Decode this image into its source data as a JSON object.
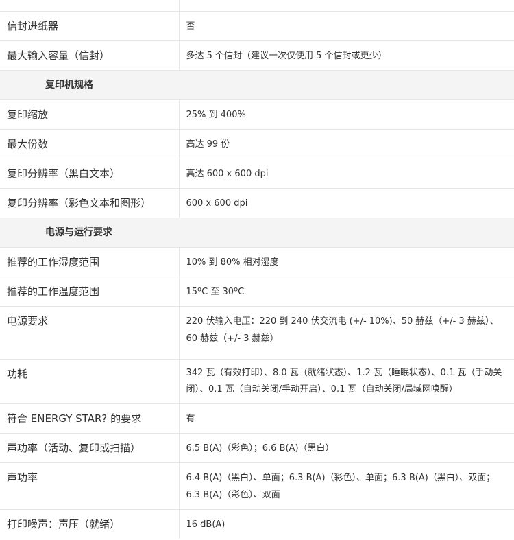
{
  "rows": [
    {
      "type": "row",
      "label": "",
      "value": ""
    },
    {
      "type": "row",
      "label": "信封进纸器",
      "value": "否"
    },
    {
      "type": "row",
      "label": "最大输入容量（信封）",
      "value": "多达 5 个信封（建议一次仅使用 5 个信封或更少）"
    },
    {
      "type": "section",
      "label": "复印机规格"
    },
    {
      "type": "row",
      "label": "复印缩放",
      "value": "25% 到 400%"
    },
    {
      "type": "row",
      "label": "最大份数",
      "value": "高达 99 份"
    },
    {
      "type": "row",
      "label": "复印分辨率（黑白文本）",
      "value": "高达 600 x 600 dpi"
    },
    {
      "type": "row",
      "label": "复印分辨率（彩色文本和图形）",
      "value": "600 x 600 dpi"
    },
    {
      "type": "section",
      "label": "电源与运行要求"
    },
    {
      "type": "row",
      "label": "推荐的工作湿度范围",
      "value": "10% 到 80% 相对湿度"
    },
    {
      "type": "row",
      "label": "推荐的工作温度范围",
      "value": "15ºC 至 30ºC"
    },
    {
      "type": "row",
      "size": "h77",
      "label": "电源要求",
      "value": "220 伏输入电压：220 到 240 伏交流电 (+/- 10%)、50 赫兹（+/- 3 赫兹）、60 赫兹（+/- 3 赫兹）"
    },
    {
      "type": "row",
      "size": "h62",
      "label": "功耗",
      "value": "342 瓦（有效打印）、8.0 瓦（就绪状态）、1.2 瓦（睡眠状态）、0.1 瓦（手动关闭）、0.1 瓦（自动关闭/手动开启）、0.1 瓦（自动关闭/局域网唤醒）"
    },
    {
      "type": "row",
      "label": "符合 ENERGY STAR? 的要求",
      "value": "有"
    },
    {
      "type": "row",
      "label": "声功率（活动、复印或扫描）",
      "value": "6.5 B(A)（彩色）；6.6 B(A)（黑白）"
    },
    {
      "type": "row",
      "size": "h68",
      "label": "声功率",
      "value": "6.4 B(A)（黑白）、单面；6.3 B(A)（彩色）、单面；6.3 B(A)（黑白）、双面；6.3 B(A)（彩色）、双面"
    },
    {
      "type": "row",
      "label": "打印噪声：声压（就绪）",
      "value": "16 dB(A)"
    }
  ]
}
